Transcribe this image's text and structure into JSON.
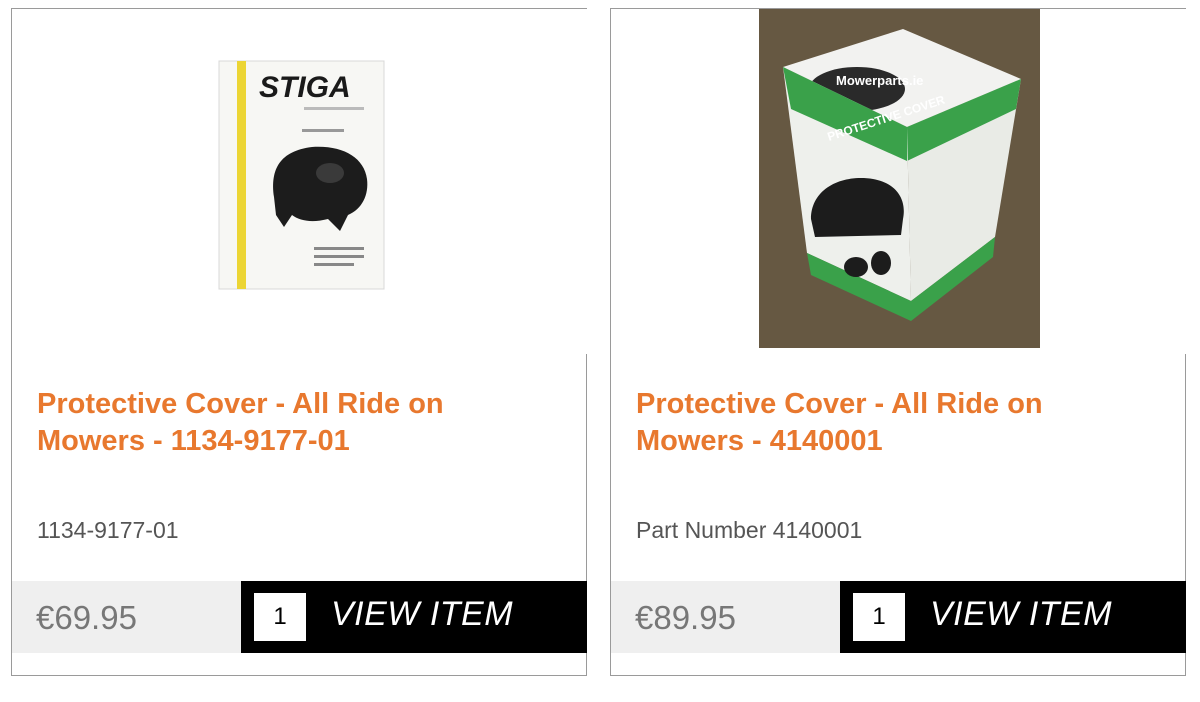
{
  "products": [
    {
      "title": "Protective Cover - All Ride on Mowers - 1134-9177-01",
      "part_number": "1134-9177-01",
      "price": "€69.95",
      "quantity": "1",
      "button_label": "VIEW ITEM",
      "image": {
        "brand_text": "STIGA",
        "icon": "stiga-protective-cover-box-image"
      }
    },
    {
      "title": "Protective Cover - All Ride on Mowers - 4140001",
      "part_number": "Part Number 4140001",
      "price": "€89.95",
      "quantity": "1",
      "button_label": "VIEW ITEM",
      "image": {
        "box_text": "Mowerparts.ie",
        "box_label": "PROTECTIVE COVER",
        "icon": "protective-cover-box-photo"
      }
    }
  ],
  "colors": {
    "title": "#e8782e",
    "button_bg": "#000000",
    "price_bg": "#efefef",
    "border": "#9a9a9a"
  }
}
